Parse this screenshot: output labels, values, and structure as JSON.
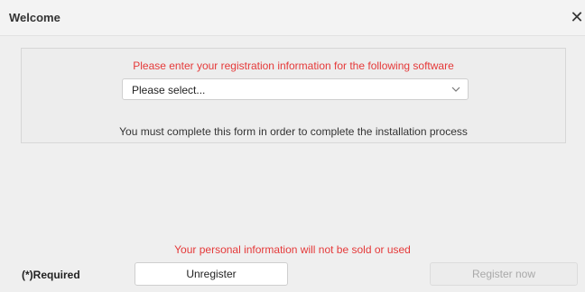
{
  "window": {
    "title": "Welcome",
    "close_glyph": "✕"
  },
  "form": {
    "prompt": "Please enter your registration information for the following software",
    "select_value": "Please select...",
    "note": "You must complete this form in order to complete the installation process"
  },
  "footer": {
    "privacy": "Your personal information will not be sold or used",
    "required": "(*)Required",
    "unregister_label": "Unregister",
    "register_label": "Register now"
  },
  "colors": {
    "warning_text": "#e53939",
    "disabled_text": "#a9a9a9"
  },
  "icons": {
    "close": "close-icon",
    "dropdown": "chevron-down-icon"
  }
}
